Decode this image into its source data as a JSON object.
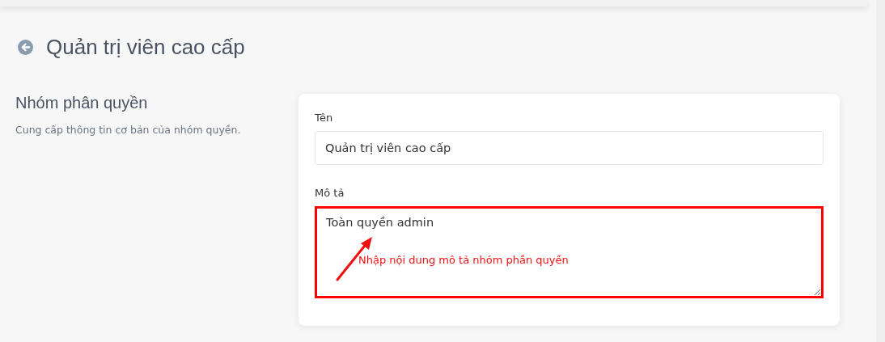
{
  "page": {
    "title": "Quản trị viên cao cấp"
  },
  "section": {
    "title": "Nhóm phân quyền",
    "description": "Cung cấp thông tin cơ bản của nhóm quyền."
  },
  "fields": [
    {
      "kind": "input",
      "label": "Tên",
      "value": "Quản trị viên cao cấp"
    },
    {
      "kind": "textarea",
      "label": "Mô tả",
      "value": "Toàn quyền admin",
      "highlighted": true,
      "annotation": "Nhập nội dung mô tả nhóm phần quyền"
    }
  ]
}
